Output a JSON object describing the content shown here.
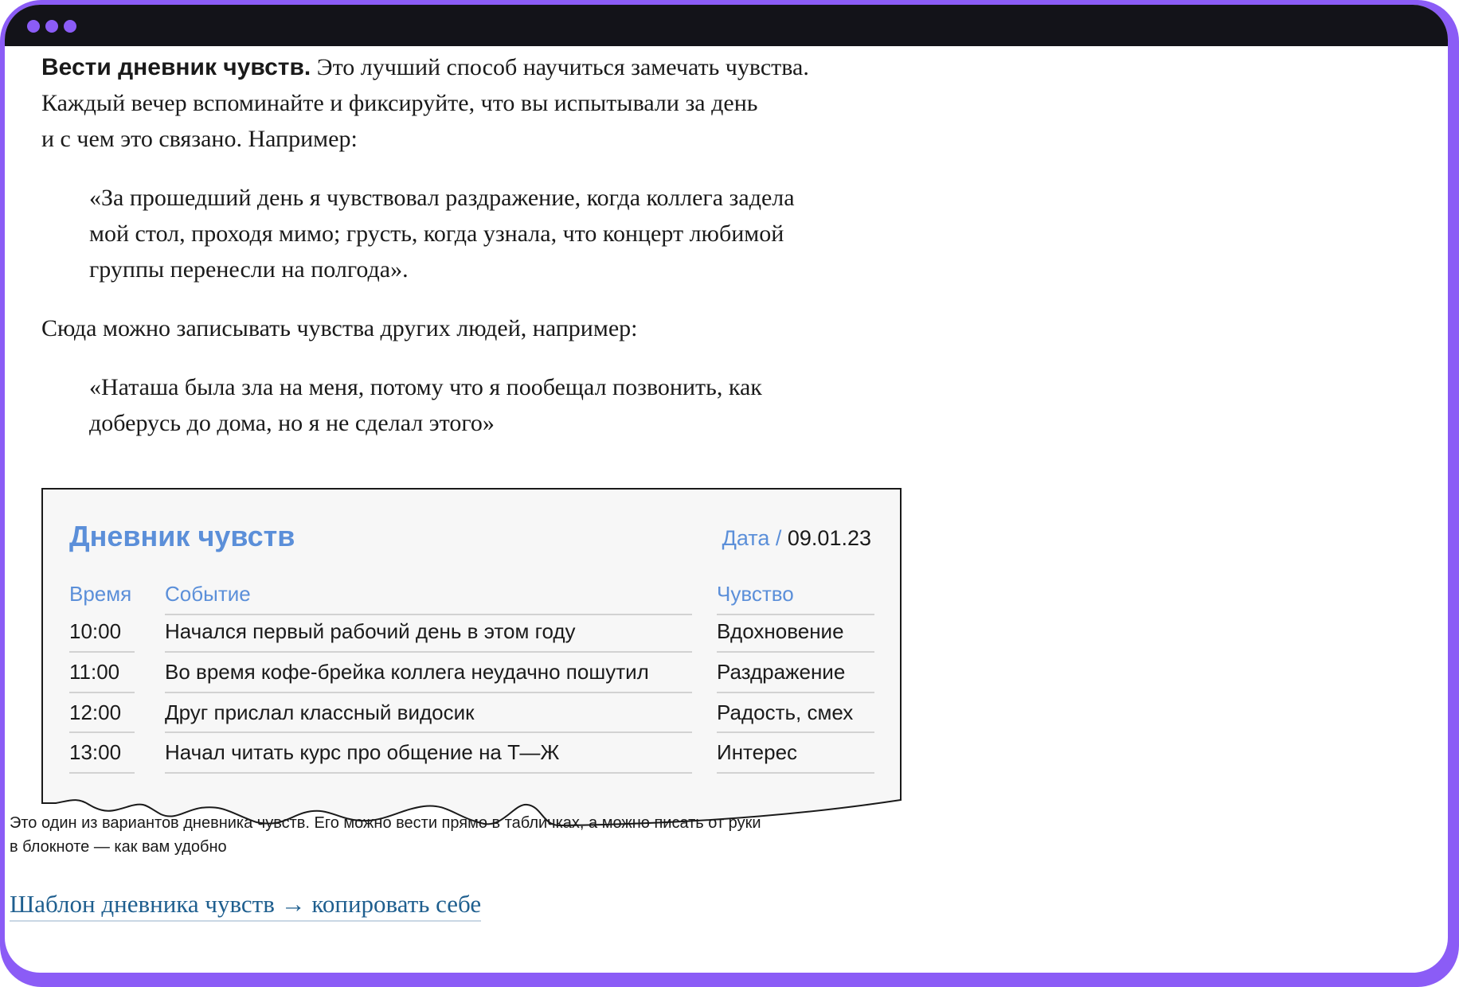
{
  "article": {
    "para1": {
      "lead": "Вести дневник чувств.",
      "line1_rest": " Это лучший способ научиться замечать чувства.",
      "line2": "Каждый вечер вспоминайте и фиксируйте, что вы испытывали за день",
      "line3": "и с чем это связано. Например:"
    },
    "quote1": {
      "line1": "«За прошедший день я чувствовал раздражение, когда коллега задела",
      "line2": "мой стол, проходя мимо; грусть, когда узнала, что концерт любимой",
      "line3": "группы перенесли на полгода»."
    },
    "para2": "Сюда можно записывать чувства других людей, например:",
    "quote2": {
      "line1": "«Наташа была зла на меня, потому что я пообещал позвонить, как",
      "line2": "доберусь до дома, но я не сделал этого»"
    }
  },
  "diary": {
    "title": "Дневник чувств",
    "date_label": "Дата /",
    "date_value": "09.01.23",
    "columns": {
      "time": "Время",
      "event": "Событие",
      "feeling": "Чувство"
    },
    "rows": [
      {
        "time": "10:00",
        "event": "Начался первый рабочий день в этом году",
        "feeling": "Вдохновение"
      },
      {
        "time": "11:00",
        "event": "Во время кофе-брейка коллега неудачно пошутил",
        "feeling": "Раздражение"
      },
      {
        "time": "12:00",
        "event": "Друг прислал классный видосик",
        "feeling": "Радость, смех"
      },
      {
        "time": "13:00",
        "event": "Начал читать курс про общение на Т—Ж",
        "feeling": "Интерес"
      }
    ]
  },
  "caption": {
    "line1": "Это один из вариантов дневника чувств. Его можно вести прямо в табличках, а можно писать от руки",
    "line2": "в блокноте — как вам удобно"
  },
  "template_link": "Шаблон дневника чувств → копировать себе",
  "colors": {
    "frame": "#8b5cf6",
    "titlebar": "#131319",
    "accent_blue": "#5b8fd9",
    "link": "#1f5f8f"
  }
}
